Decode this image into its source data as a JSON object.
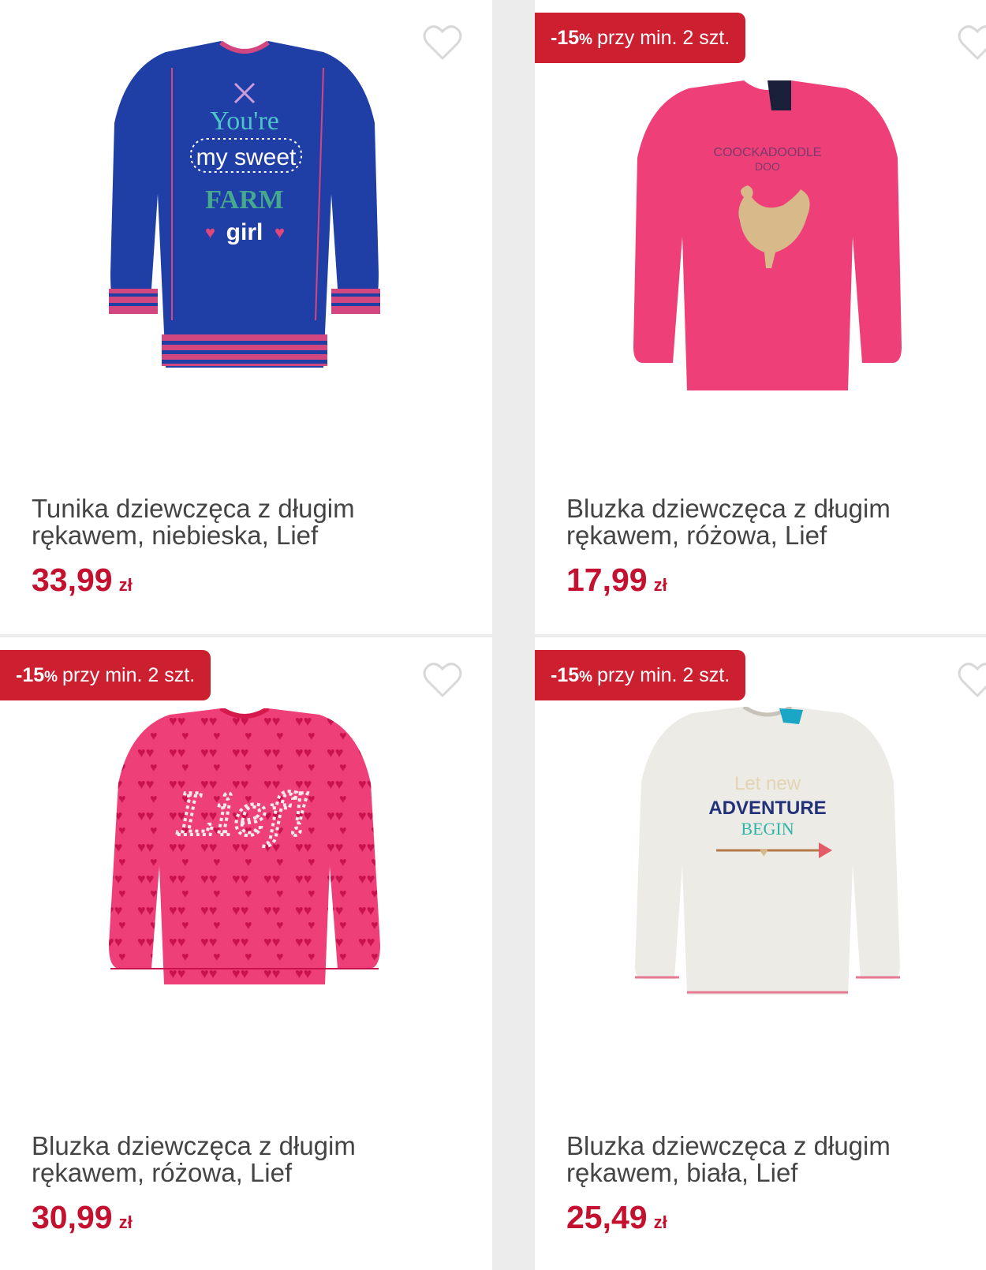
{
  "products": [
    {
      "title": "Tunika dziewczęca z długim rękawem, niebieska, Lief",
      "price": "33,99",
      "currency": "zł",
      "badge": null,
      "image_text": [
        "You're",
        "my sweet",
        "FARM",
        "girl"
      ]
    },
    {
      "title": "Bluzka dziewczęca z długim rękawem, różowa, Lief",
      "price": "17,99",
      "currency": "zł",
      "badge": {
        "percent": "-15",
        "percent_sign": "%",
        "text": "przy min. 2 szt."
      },
      "image_text": [
        "COOCKADOODLE",
        "DOO"
      ]
    },
    {
      "title": "Bluzka dziewczęca z długim rękawem, różowa, Lief",
      "price": "30,99",
      "currency": "zł",
      "badge": {
        "percent": "-15",
        "percent_sign": "%",
        "text": "przy min. 2 szt."
      },
      "image_text": [
        "Lief!"
      ]
    },
    {
      "title": "Bluzka dziewczęca z długim rękawem, biała, Lief",
      "price": "25,49",
      "currency": "zł",
      "badge": {
        "percent": "-15",
        "percent_sign": "%",
        "text": "przy min. 2 szt."
      },
      "image_text": [
        "Let new",
        "ADVENTURE",
        "BEGIN"
      ]
    }
  ],
  "colors": {
    "badge": "#cc1f30",
    "price": "#c4112f",
    "title": "#444444",
    "heart_outline": "#d8d8d8"
  },
  "icons": {
    "wishlist": "heart-outline-icon"
  }
}
